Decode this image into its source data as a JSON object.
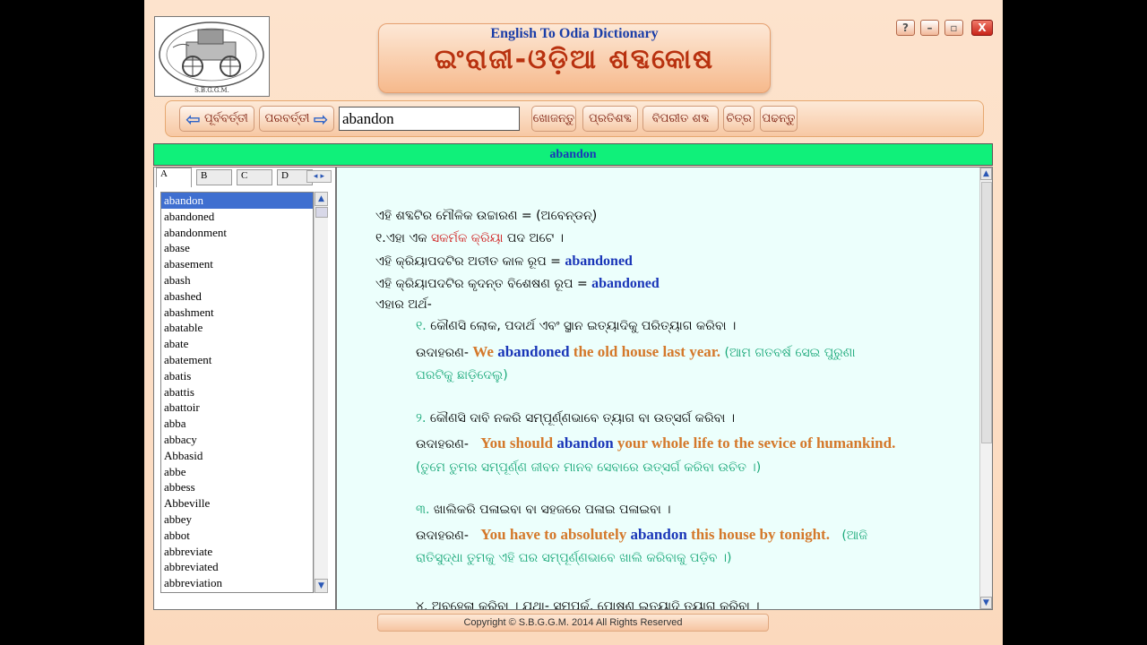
{
  "window": {
    "title_en": "English To Odia Dictionary",
    "title_od": "ଇଂରାଜୀ-ଓଡ଼ିଆ ଶବ୍ଦକୋଷ",
    "logo_caption": "S.B.G.G.M.",
    "help": "?",
    "min": "–",
    "max": "▫",
    "close": "X"
  },
  "toolbar": {
    "prev_label": "ପୂର୍ବବର୍ତ୍ତୀ",
    "next_label": "ପରବର୍ତ୍ତୀ",
    "search_value": "abandon",
    "search_btn": "ଖୋଜନ୍ତୁ",
    "synonym_btn": "ପ୍ରତିଶବ୍ଦ",
    "antonym_btn": "ବିପରୀତ ଶବ୍ଦ",
    "picture_btn": "ଚିତ୍ର",
    "read_btn": "ପଢନ୍ତୁ"
  },
  "current_word": "abandon",
  "tabs": [
    "A",
    "B",
    "C",
    "D"
  ],
  "words": [
    "abandon",
    "abandoned",
    "abandonment",
    "abase",
    "abasement",
    "abash",
    "abashed",
    "abashment",
    "abatable",
    "abate",
    "abatement",
    "abatis",
    "abattis",
    "abattoir",
    "abba",
    "abbacy",
    "Abbasid",
    "abbe",
    "abbess",
    "Abbeville",
    "abbey",
    "abbot",
    "abbreviate",
    "abbreviated",
    "abbreviation"
  ],
  "entry": {
    "pron": "ଏହି ଶବ୍ଦଟିର ମୌଳିକ ଉଚ୍ଚାରଣ = (ଅବେନ୍‌ଡନ୍)",
    "pos_pre": "୧.ଏହା ଏକ ",
    "pos_word": "ସକର୍ମକ କ୍ରିୟା",
    "pos_post": " ପଦ ଅଟେ ।",
    "past_pre": "ଏହି କ୍ରିୟାପଦଟିର ଅତୀତ କାଳ ରୂପ = ",
    "past_val": "abandoned",
    "part_pre": "ଏହି କ୍ରିୟାପଦଟିର କୃଦନ୍ତ ବିଶେଷଣ ରୂପ = ",
    "part_val": "abandoned",
    "meaning_label": "ଏହାର ଅର୍ଥ-",
    "example_label": "ଉଦାହରଣ-",
    "m1_num": "୧.",
    "m1": "କୌଣସି ଲୋକ, ପଦାର୍ଥ ଏବଂ ସ୍ଥାନ ଇତ୍ୟାଦିକୁ ପରିତ୍ୟାଗ କରିବା ।",
    "e1_a": "We ",
    "e1_b": "abandoned",
    "e1_c": " the old house last year.",
    "e1_od1": "(ଆମ ଗତବର୍ଷ ସେଇ ପୁରୁଣା",
    "e1_od2": "ଘରଟିକୁ ଛାଡ଼ିଦେଲୁ)",
    "m2_num": "୨.",
    "m2": "କୌଣସି ଦାବି ନକରି ସମ୍ପୂର୍ଣ୍ଣଭାବେ ତ୍ୟାଗ ବା ଉତ୍ସର୍ଗ କରିବା ।",
    "e2_a": "You should ",
    "e2_b": "abandon",
    "e2_c": " your whole life to the sevice of humankind.",
    "e2_od": "(ତୁମେ ତୁମର ସମ୍ପୂର୍ଣ୍ଣ ଜୀବନ ମାନବ ସେବାରେ ଉତ୍ସର୍ଗ କରିବା ଉଚିତ ।)",
    "m3_num": "୩.",
    "m3": "ଖାଲିକରି ପଳାଇବା ବା ସହଜରେ ପଳାଇ ପଳାଇବା ।",
    "e3_a": "You have to absolutely ",
    "e3_b": "abandon",
    "e3_c": " this house by tonight.",
    "e3_od1": "(ଆଜି",
    "e3_od2": "ରାତିସୁଦ୍ଧା ତୁମକୁ ଏହି ଘର ସମ୍ପୂର୍ଣ୍ଣଭାବେ ଖାଲି କରିବାକୁ ପଡ଼ିବ ।)",
    "m4_partial": "୪. ଅବହେଳା କରିବା । ଯଥା- ସମ୍ପର୍କ, ପୋଷଣ ଇତ୍ୟାଦି ତ୍ୟାଗ କରିବା ।"
  },
  "footer": "Copyright © S.B.G.G.M. 2014 All Rights Reserved"
}
